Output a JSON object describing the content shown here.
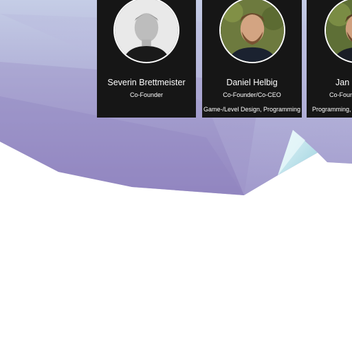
{
  "team": [
    {
      "name": "Severin Brettmeister",
      "role": "Co-Founder",
      "skills": "",
      "photo": "grayscale-portrait"
    },
    {
      "name": "Daniel Helbig",
      "role": "Co-Founder/Co-CEO",
      "skills": "Game-/Level Design, Programming",
      "photo": "color-portrait"
    },
    {
      "name": "Jan B",
      "role": "Co-Foun",
      "skills": "Programming, A",
      "photo": "color-portrait"
    }
  ],
  "colors": {
    "card_bg": "#161616",
    "bg_purple": "#9d90c6",
    "bg_lavender": "#c4c7e3",
    "bg_ice": "#c6e8ef"
  }
}
